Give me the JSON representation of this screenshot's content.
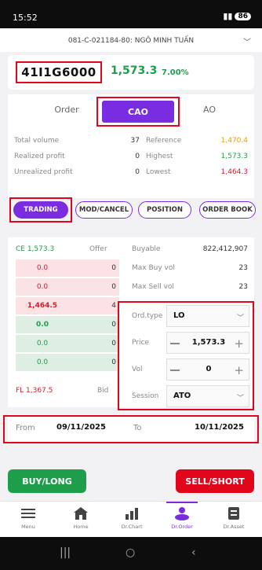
{
  "status_bar": {
    "time": "15:52",
    "battery": "86"
  },
  "account": {
    "label": "081-C-021184-80: NGÔ MINH TUẤN"
  },
  "symbol": {
    "code": "41I1G6000",
    "price": "1,573.3",
    "change_pct": "7.00%"
  },
  "order_tabs": [
    {
      "label": "Order"
    },
    {
      "label": "CAO"
    },
    {
      "label": "AO"
    }
  ],
  "stats": {
    "total_volume_label": "Total volume",
    "total_volume": "37",
    "reference_label": "Reference",
    "reference": "1,470.4",
    "realized_label": "Realized profit",
    "realized": "0",
    "highest_label": "Highest",
    "highest": "1,573.3",
    "unrealized_label": "Unrealized profit",
    "unrealized": "0",
    "lowest_label": "Lowest",
    "lowest": "1,464.3"
  },
  "function_tabs": [
    {
      "label": "TRADING"
    },
    {
      "label": "MOD/CANCEL"
    },
    {
      "label": "POSITION"
    },
    {
      "label": "ORDER BOOK"
    }
  ],
  "orderbook": {
    "ce_label": "CE 1,573.3",
    "offer_label": "Offer",
    "fl_label": "FL 1,367.5",
    "bid_label": "Bid",
    "asks": [
      {
        "price": "0.0",
        "qty": "0"
      },
      {
        "price": "0.0",
        "qty": "0"
      },
      {
        "price": "1,464.5",
        "qty": "4"
      }
    ],
    "bids": [
      {
        "price": "0.0",
        "qty": "0"
      },
      {
        "price": "0.0",
        "qty": "0"
      },
      {
        "price": "0.0",
        "qty": "0"
      }
    ]
  },
  "info": {
    "buyable_label": "Buyable",
    "buyable": "822,412,907",
    "max_buy_label": "Max Buy vol",
    "max_buy": "23",
    "max_sell_label": "Max Sell vol",
    "max_sell": "23"
  },
  "form": {
    "ord_type_label": "Ord.type",
    "ord_type": "LO",
    "price_label": "Price",
    "price": "1,573.3",
    "vol_label": "Vol",
    "vol": "0",
    "session_label": "Session",
    "session": "ATO"
  },
  "dates": {
    "from_label": "From",
    "from": "09/11/2025",
    "to_label": "To",
    "to": "10/11/2025"
  },
  "buttons": {
    "buy": "BUY/LONG",
    "sell": "SELL/SHORT"
  },
  "nav": [
    {
      "label": "Menu"
    },
    {
      "label": "Home"
    },
    {
      "label": "Dr.Chart"
    },
    {
      "label": "Dr.Order"
    },
    {
      "label": "Dr.Asset"
    }
  ],
  "colors": {
    "accent": "#7a2ce0",
    "up": "#1e9d4b",
    "down": "#e1061b",
    "reference": "#e3a00e"
  }
}
